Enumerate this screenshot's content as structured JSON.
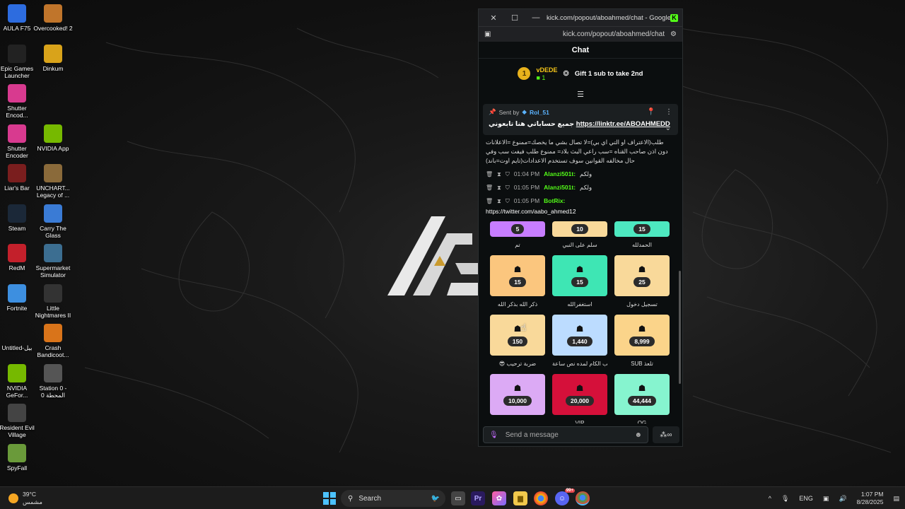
{
  "desktop": {
    "icons": [
      {
        "label": "AULA F75",
        "icon": "keyboard-icon",
        "color": "#2d6cdf"
      },
      {
        "label": "Overcooked! 2",
        "icon": "game-icon",
        "color": "#c0752b"
      },
      {
        "label": "Epic Games Launcher",
        "icon": "epic-icon",
        "color": "#222222"
      },
      {
        "label": "Dinkum",
        "icon": "game-icon",
        "color": "#d9a31a"
      },
      {
        "label": "Shutter Encod...",
        "icon": "shutter-icon",
        "color": "#d83a8f"
      },
      {
        "label": "Shutter Encoder",
        "icon": "shutter-icon",
        "color": "#d83a8f"
      },
      {
        "label": "NVIDIA App",
        "icon": "nvidia-icon",
        "color": "#76b900"
      },
      {
        "label": "Liar's Bar",
        "icon": "game-icon",
        "color": "#7a1e1e"
      },
      {
        "label": "UNCHART... Legacy of ...",
        "icon": "game-icon",
        "color": "#8a6a3a"
      },
      {
        "label": "Steam",
        "icon": "steam-icon",
        "color": "#1b2838"
      },
      {
        "label": "Carry The Glass",
        "icon": "game-icon",
        "color": "#3a7bd5"
      },
      {
        "label": "RedM",
        "icon": "redm-icon",
        "color": "#c3202b"
      },
      {
        "label": "Supermarket Simulator",
        "icon": "game-icon",
        "color": "#3c6e91"
      },
      {
        "label": "Fortnite",
        "icon": "fortnite-icon",
        "color": "#3d8fe0"
      },
      {
        "label": "Little Nightmares II",
        "icon": "game-icon",
        "color": "#333333"
      },
      {
        "label": "Untitled-بيل",
        "icon": "file-icon",
        "color": "#111111"
      },
      {
        "label": "Crash Bandicoot...",
        "icon": "game-icon",
        "color": "#d9741a"
      },
      {
        "label": "NVIDIA GeFor...",
        "icon": "nvidia-icon",
        "color": "#76b900"
      },
      {
        "label": "Station 0 - المحطة 0",
        "icon": "game-icon",
        "color": "#555555"
      },
      {
        "label": "Resident Evil Village",
        "icon": "game-icon",
        "color": "#444444"
      },
      {
        "label": "SpyFall",
        "icon": "game-icon",
        "color": "#6a9a3a"
      }
    ]
  },
  "window": {
    "title": "kick.com/popout/aboahmed/chat - Google Chro...",
    "url": "kick.com/popout/aboahmed/chat",
    "close_glyph": "✕",
    "maximize_glyph": "☐",
    "minimize_glyph": "—",
    "kick_letter": "K"
  },
  "chat": {
    "header": "Chat",
    "leader": {
      "rank": "1",
      "name": "vDEDE",
      "count": "1"
    },
    "gift_text": "Gift 1 sub to take 2nd",
    "pinned": {
      "sent_by": "Sent by",
      "user": "Rol_51",
      "text": "جميع حساباتي هنا تابعوني",
      "link": "https://linktr.ee/ABOAHMEDD"
    },
    "rules_text": "طلب(الاعتراف او التي اي بي)=لا تصال بشي ما يخصك=ممنوع =الاعلانات دون اذن صاحب القناه =سب راعي البث بلاد= ممنوع طلب فيفت سب وفي حال مخالفه القوانين سوف تستخدم الاعدادات(تايم اوت=باند)",
    "messages": [
      {
        "time": "01:04 PM",
        "user": "Alanzi501t:",
        "text": "ولكم"
      },
      {
        "time": "01:05 PM",
        "user": "Alanzi501t:",
        "text": "ولكم"
      },
      {
        "time": "01:05 PM",
        "user": "BotRix:",
        "text": ""
      }
    ],
    "link_message": "https://twitter.com/aabo_ahmed12",
    "input_placeholder": "Send a message",
    "send_label": "∞"
  },
  "rewards": {
    "top_row": [
      {
        "cost": "5",
        "label": "تم",
        "color": "#c77dff"
      },
      {
        "cost": "10",
        "label": "سلم على النبي",
        "color": "#f9d99a"
      },
      {
        "cost": "15",
        "label": "الحمدلله",
        "color": "#4de8c0"
      }
    ],
    "rows": [
      [
        {
          "cost": "15",
          "label": "ذكر الله بذكر الله",
          "color": "#fbc67e"
        },
        {
          "cost": "15",
          "label": "استغفرالله",
          "color": "#3ee6b4"
        },
        {
          "cost": "25",
          "label": "تسجيل دخول",
          "color": "#f9d99a"
        }
      ],
      [
        {
          "cost": "150",
          "label": "😎 ضربة ترحيب",
          "color": "#f9d99a"
        },
        {
          "cost": "1,440",
          "label": "طلب الكام لمده نص ساعة",
          "color": "#bcdcff"
        },
        {
          "cost": "8,999",
          "label": "SUB تلعذ",
          "color": "#fbd48a"
        }
      ],
      [
        {
          "cost": "10,000",
          "label": "...",
          "color": "#dcaaf5"
        },
        {
          "cost": "20,000",
          "label": "VIP",
          "color": "#d5103a"
        },
        {
          "cost": "44,444",
          "label": "OG",
          "color": "#86f4cf"
        }
      ]
    ]
  },
  "taskbar": {
    "weather_temp": "39°C",
    "weather_desc": "مشمس",
    "search_label": "Search",
    "lang": "ENG",
    "time": "1:07 PM",
    "date": "8/28/2025",
    "discord_badge": "99+"
  }
}
